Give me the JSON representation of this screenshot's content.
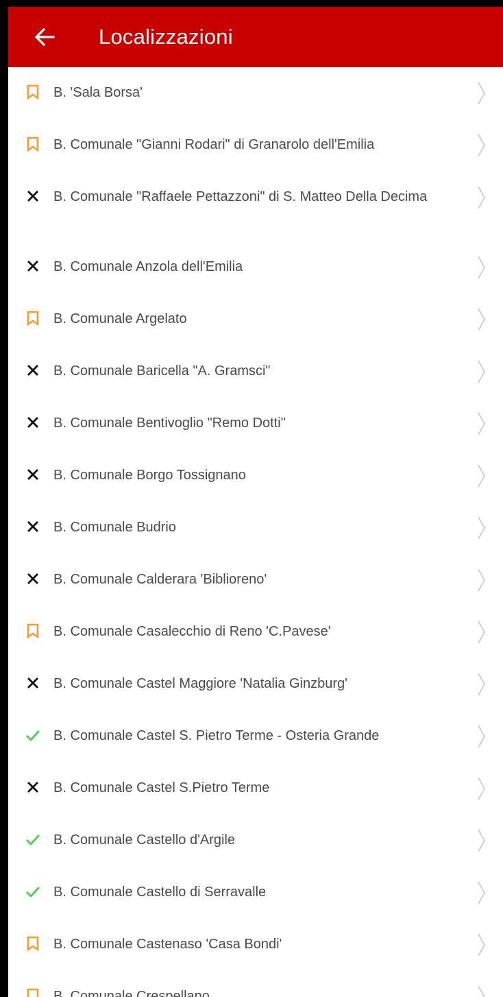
{
  "header": {
    "title": "Localizzazioni",
    "back_icon": "arrow-left-icon"
  },
  "colors": {
    "appbar": "#c90000",
    "bookmark": "#f39a33",
    "check": "#4ccd4c",
    "cross": "#111111",
    "text": "#4a4a4a",
    "chevron": "#c7c7c7"
  },
  "items": [
    {
      "label": "B. 'Sala Borsa'",
      "status": "bookmark"
    },
    {
      "label": "B. Comunale \"Gianni Rodari\" di Granarolo dell'Emilia",
      "status": "bookmark"
    },
    {
      "label": "B. Comunale \"Raffaele Pettazzoni\" di S. Matteo Della Decima",
      "status": "cross"
    },
    {
      "label": "B. Comunale Anzola dell'Emilia",
      "status": "cross"
    },
    {
      "label": "B. Comunale Argelato",
      "status": "bookmark"
    },
    {
      "label": "B. Comunale Baricella \"A. Gramsci\"",
      "status": "cross"
    },
    {
      "label": "B. Comunale Bentivoglio \"Remo Dotti\"",
      "status": "cross"
    },
    {
      "label": "B. Comunale Borgo Tossignano",
      "status": "cross"
    },
    {
      "label": "B. Comunale Budrio",
      "status": "cross"
    },
    {
      "label": "B. Comunale Calderara 'Biblioreno'",
      "status": "cross"
    },
    {
      "label": "B. Comunale Casalecchio di Reno 'C.Pavese'",
      "status": "bookmark"
    },
    {
      "label": "B. Comunale Castel Maggiore 'Natalia Ginzburg'",
      "status": "cross"
    },
    {
      "label": "B. Comunale Castel S. Pietro Terme - Osteria Grande",
      "status": "check"
    },
    {
      "label": "B. Comunale Castel S.Pietro Terme",
      "status": "cross"
    },
    {
      "label": "B. Comunale Castello d'Argile",
      "status": "check"
    },
    {
      "label": "B. Comunale Castello di Serravalle",
      "status": "check"
    },
    {
      "label": "B. Comunale Castenaso 'Casa Bondi'",
      "status": "bookmark"
    },
    {
      "label": "B. Comunale Crespellano",
      "status": "bookmark"
    }
  ]
}
